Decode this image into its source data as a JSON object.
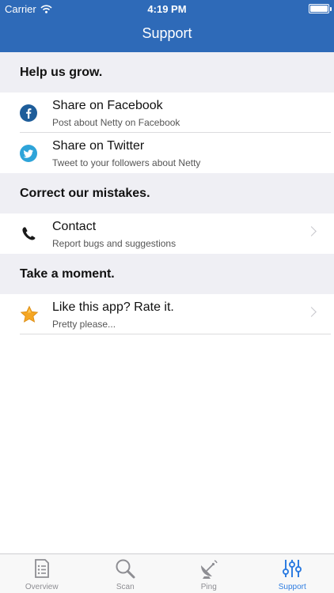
{
  "status_bar": {
    "carrier": "Carrier",
    "time": "4:19 PM"
  },
  "nav": {
    "title": "Support"
  },
  "sections": [
    {
      "header": "Help us grow.",
      "rows": [
        {
          "title": "Share on Facebook",
          "subtitle": "Post about Netty on Facebook",
          "icon": "facebook-icon"
        },
        {
          "title": "Share on Twitter",
          "subtitle": "Tweet to your followers about Netty",
          "icon": "twitter-icon"
        }
      ]
    },
    {
      "header": "Correct our mistakes.",
      "rows": [
        {
          "title": "Contact",
          "subtitle": "Report bugs and suggestions",
          "icon": "phone-icon"
        }
      ]
    },
    {
      "header": "Take a moment.",
      "rows": [
        {
          "title": "Like this app? Rate it.",
          "subtitle": "Pretty please...",
          "icon": "star-icon"
        }
      ]
    }
  ],
  "tabs": [
    {
      "label": "Overview",
      "icon": "document-list-icon"
    },
    {
      "label": "Scan",
      "icon": "magnifier-icon"
    },
    {
      "label": "Ping",
      "icon": "satellite-dish-icon"
    },
    {
      "label": "Support",
      "icon": "sliders-icon"
    }
  ],
  "colors": {
    "nav_bar": "#2e6ab8",
    "section_background": "#efeff4",
    "tab_active": "#2f7de1",
    "tab_inactive": "#8e8e93",
    "facebook": "#1e5d9a",
    "twitter": "#2ea4d9",
    "star": "#f5a623"
  }
}
